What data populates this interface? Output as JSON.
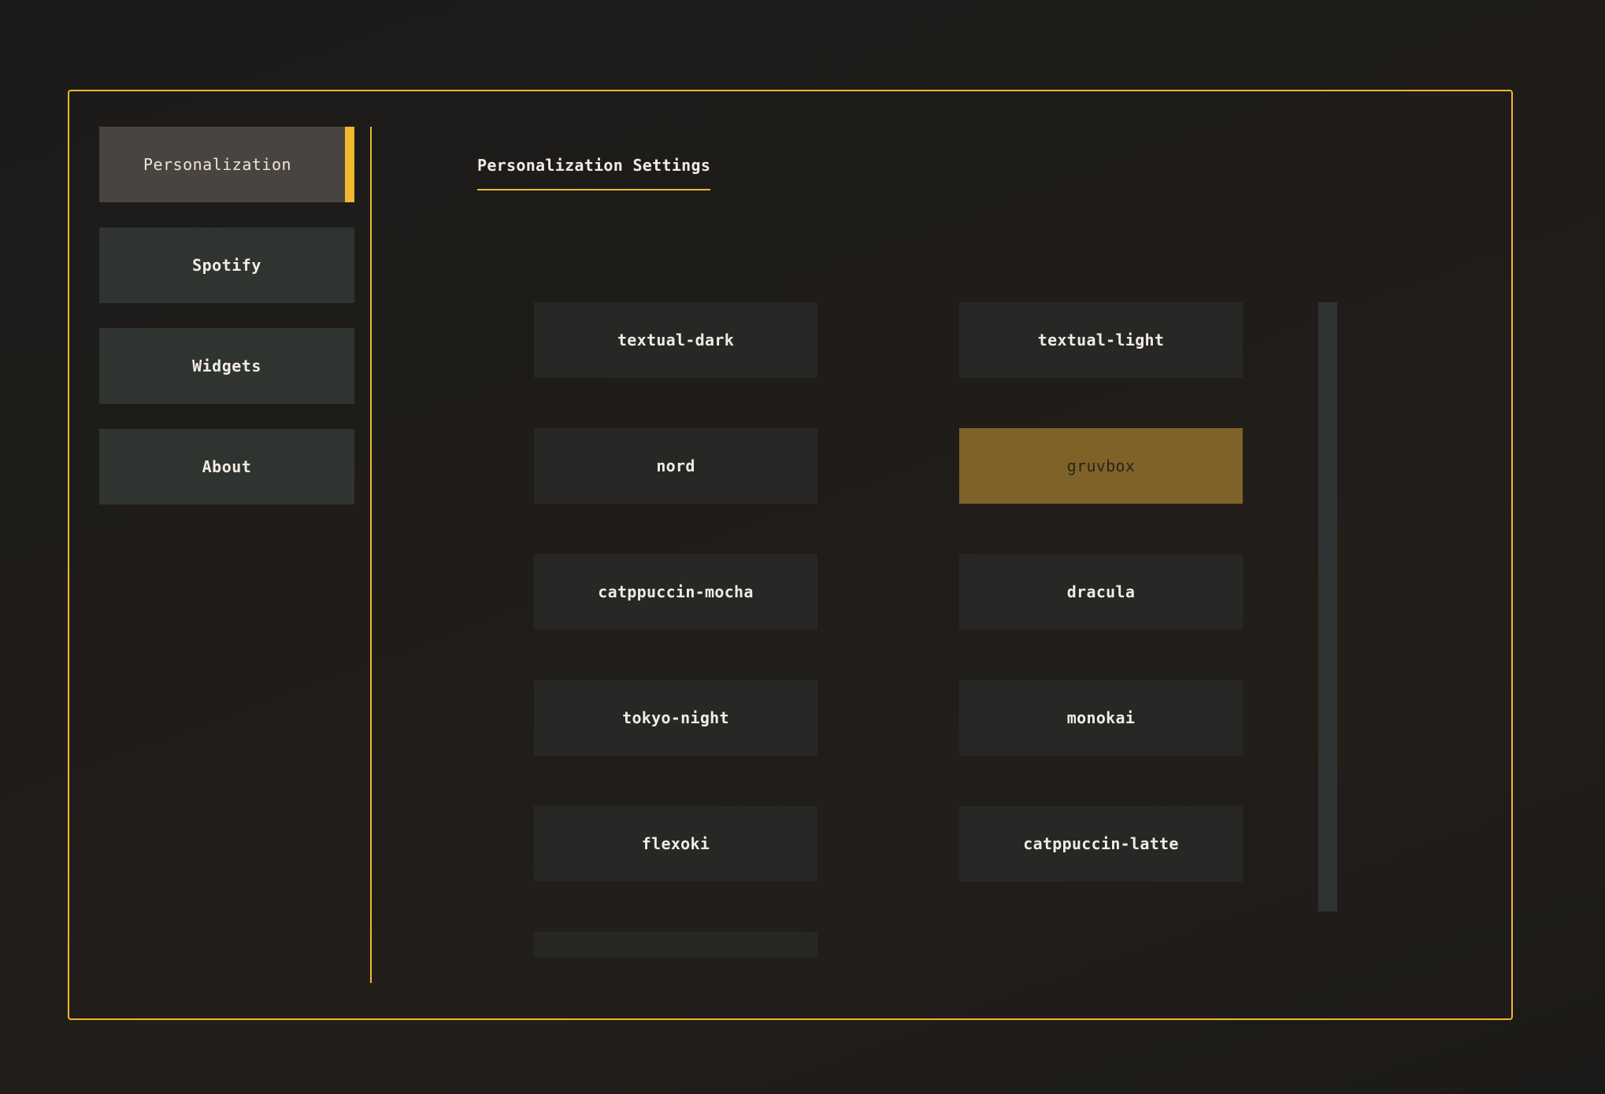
{
  "sidebar": {
    "items": [
      {
        "label": "Personalization",
        "active": true
      },
      {
        "label": "Spotify",
        "active": false
      },
      {
        "label": "Widgets",
        "active": false
      },
      {
        "label": "About",
        "active": false
      }
    ]
  },
  "panel": {
    "title": "Personalization Settings"
  },
  "themes": {
    "selected": "gruvbox",
    "items": [
      "textual-dark",
      "textual-light",
      "nord",
      "gruvbox",
      "catppuccin-mocha",
      "dracula",
      "tokyo-night",
      "monokai",
      "flexoki",
      "catppuccin-latte",
      ""
    ]
  },
  "colors": {
    "accent": "#f0b72f",
    "selected_theme_bg": "#7f6228",
    "button_bg": "#303431",
    "active_nav_bg": "#49443f"
  }
}
